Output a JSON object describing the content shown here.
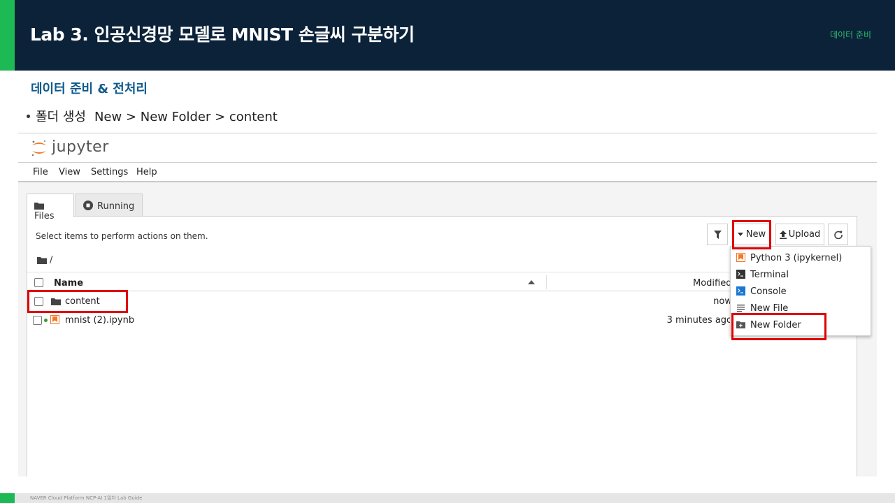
{
  "header": {
    "title": "Lab 3. 인공신경망 모델로 MNIST 손글씨 구분하기",
    "tag": "데이터 준비"
  },
  "section": {
    "title": "데이터 준비 & 전처리",
    "bullet_label": "폴더 생성",
    "bullet_path": "New > New Folder > content"
  },
  "jupyter": {
    "logo_text": "jupyter",
    "menu": [
      "File",
      "View",
      "Settings",
      "Help"
    ],
    "tabs": [
      {
        "label": "Files",
        "icon": "folder-icon"
      },
      {
        "label": "Running",
        "icon": "stop-circle-icon"
      }
    ],
    "panel_message": "Select items to perform actions on them.",
    "breadcrumb": "/",
    "toolbar": {
      "new_label": "New",
      "upload_label": "Upload"
    },
    "columns": {
      "name": "Name",
      "modified": "Modified"
    },
    "files": [
      {
        "name": "content",
        "modified": "now",
        "icon": "folder-icon",
        "type": "folder"
      },
      {
        "name": "mnist (2).ipynb",
        "modified": "3 minutes ago",
        "icon": "notebook-icon",
        "type": "notebook",
        "running": true
      }
    ],
    "new_menu": [
      {
        "label": "Python 3 (ipykernel)",
        "icon": "notebook-icon"
      },
      {
        "label": "Terminal",
        "icon": "terminal-icon"
      },
      {
        "label": "Console",
        "icon": "console-icon"
      },
      {
        "label": "New File",
        "icon": "text-file-icon"
      },
      {
        "label": "New Folder",
        "icon": "new-folder-icon"
      }
    ]
  },
  "colors": {
    "header_bg": "#0b2239",
    "accent_green": "#1db954",
    "section_blue": "#0f5a8c",
    "highlight_red": "#e00000",
    "jupyter_orange": "#f37726"
  },
  "footer": {
    "text": "NAVER Cloud Platform NCP-AI 1일차 Lab Guide"
  }
}
